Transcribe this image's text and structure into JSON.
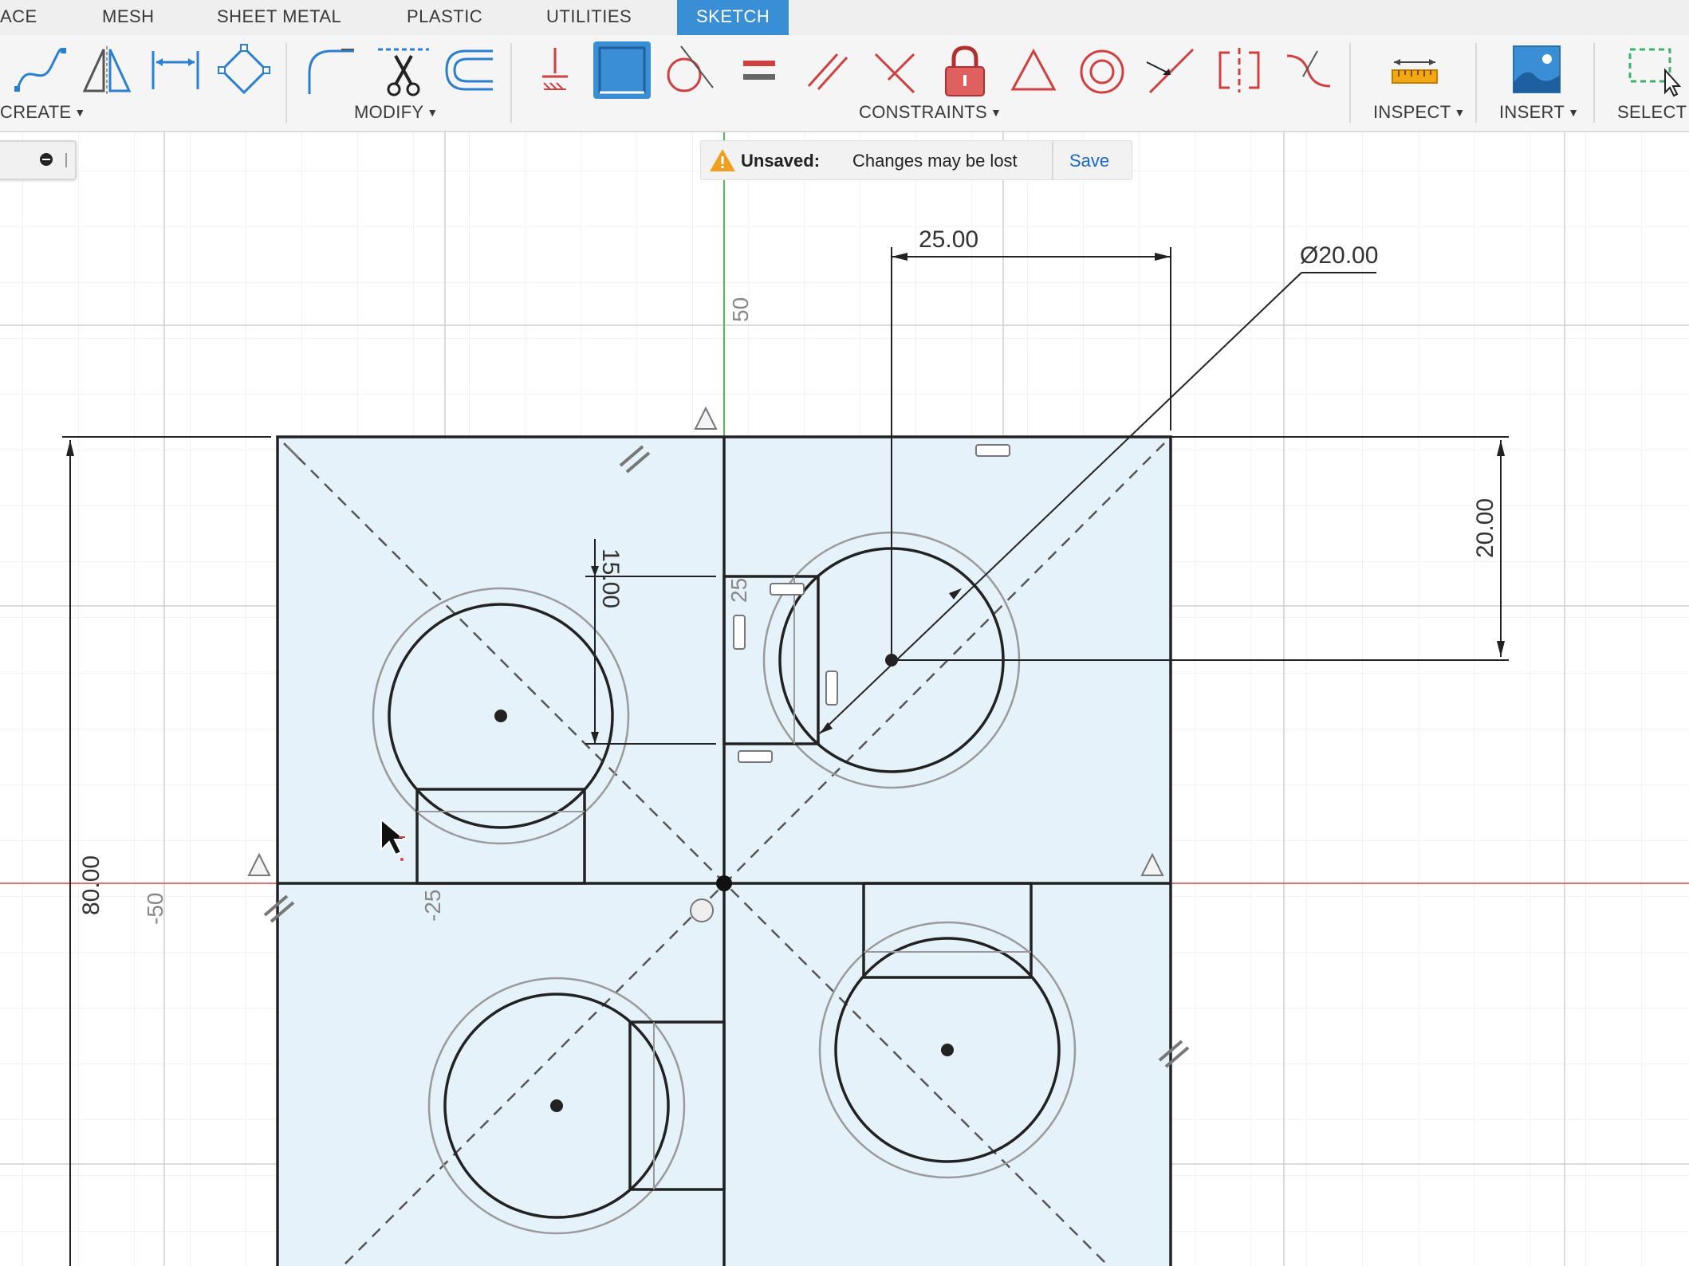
{
  "tabs": [
    "ACE",
    "MESH",
    "SHEET METAL",
    "PLASTIC",
    "UTILITIES",
    "SKETCH"
  ],
  "active_tab": "SKETCH",
  "groups": {
    "create": "CREATE",
    "modify": "MODIFY",
    "constraints": "CONSTRAINTS",
    "inspect": "INSPECT",
    "insert": "INSERT",
    "select": "SELECT"
  },
  "tool_icons": {
    "create": [
      "spline-icon",
      "mirror-icon",
      "dimension-icon",
      "polygon-icon"
    ],
    "modify": [
      "fillet-icon",
      "trim-icon",
      "offset-icon"
    ],
    "constraints": [
      "fix-icon",
      "rectangle-tool-icon",
      "tangent-icon",
      "equal-icon",
      "parallel-icon",
      "perpendicular-icon",
      "lock-icon",
      "horizontal-vertical-icon",
      "concentric-icon",
      "midpoint-icon",
      "symmetry-icon",
      "curvature-icon"
    ],
    "inspect": [
      "measure-icon"
    ],
    "insert": [
      "insert-image-icon"
    ],
    "select": [
      "window-select-icon"
    ]
  },
  "notification": {
    "title": "Unsaved:",
    "message": "Changes may be lost",
    "action": "Save"
  },
  "dimensions": {
    "horizontal": "25.00",
    "diameter": "Ø20.00",
    "vertical_right": "20.00",
    "vertical_small": "15.00",
    "overall": "80.00"
  },
  "axis_labels": {
    "y_50": "50",
    "x_neg50": "-50",
    "x_neg25": "-25",
    "small_25": "25"
  },
  "colors": {
    "accent": "#3a8fd4",
    "sketch_fill": "#e6f2fa",
    "x_axis": "#e05050",
    "y_axis": "#4cc24c",
    "constraint_red": "#d04040",
    "link": "#1967c0"
  }
}
